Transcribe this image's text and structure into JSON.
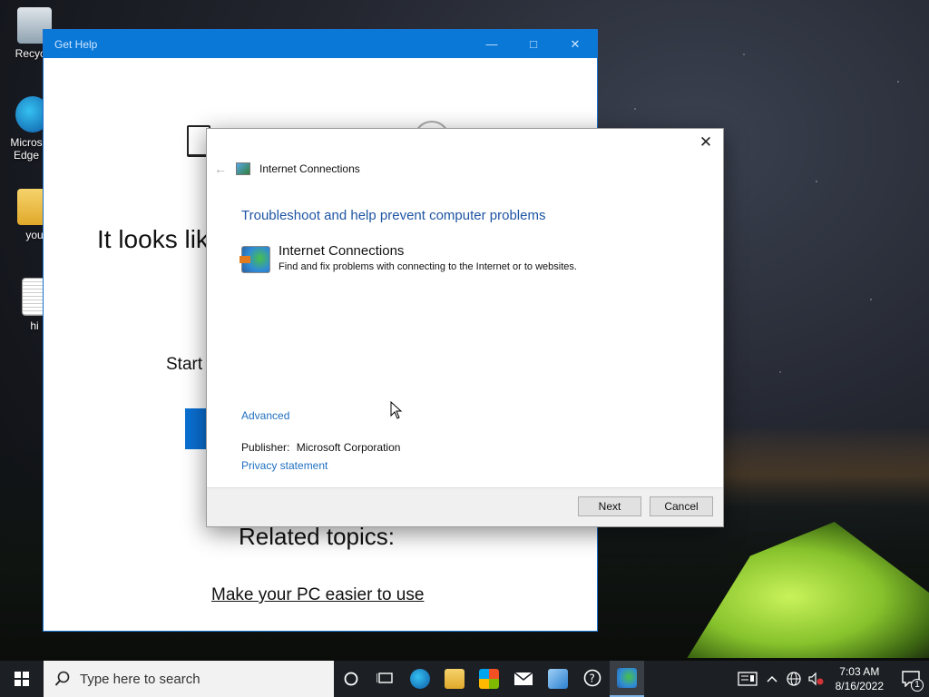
{
  "desktop": {
    "icons": [
      {
        "label": "Recycle"
      },
      {
        "label": "Micros Edge"
      },
      {
        "label": "you"
      },
      {
        "label": "hi"
      }
    ]
  },
  "get_help": {
    "title": "Get Help",
    "heading": "It looks lik",
    "start_text": "Start",
    "related_topics": "Related topics:",
    "link": "Make your PC easier to use"
  },
  "dialog": {
    "nav_title": "Internet Connections",
    "heading": "Troubleshoot and help prevent computer problems",
    "item_title": "Internet Connections",
    "item_desc": "Find and fix problems with connecting to the Internet or to websites.",
    "advanced": "Advanced",
    "publisher_label": "Publisher:",
    "publisher_value": "Microsoft Corporation",
    "privacy": "Privacy statement",
    "next": "Next",
    "cancel": "Cancel"
  },
  "taskbar": {
    "search_placeholder": "Type here to search",
    "time": "7:03 AM",
    "date": "8/16/2022",
    "notifications": "1"
  }
}
